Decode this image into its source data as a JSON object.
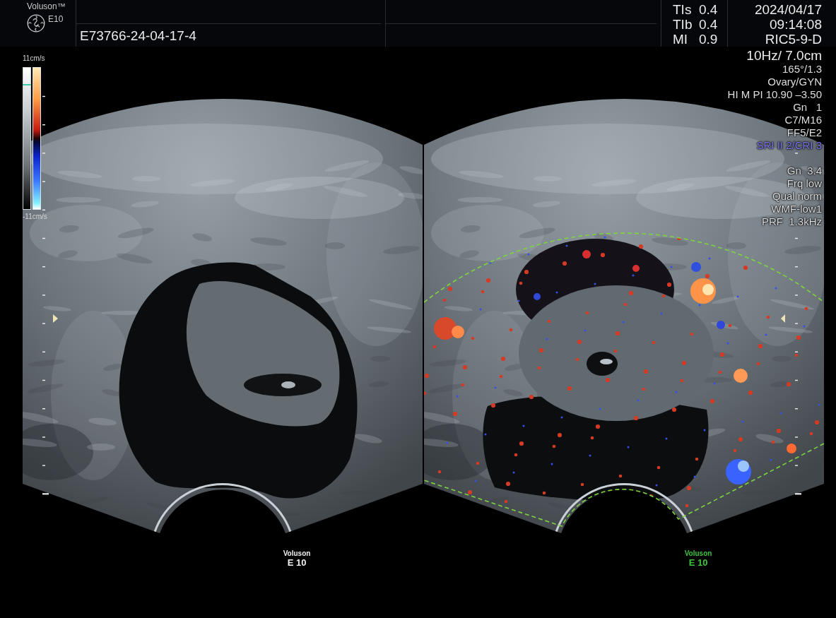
{
  "header": {
    "brand": "Voluson™",
    "model": "E10",
    "patient_id": "E73766-24-04-17-4"
  },
  "acoustic_output": [
    {
      "label": "TIs",
      "value": "0.4"
    },
    {
      "label": "TIb",
      "value": "0.4"
    },
    {
      "label": "MI",
      "value": "0.9"
    }
  ],
  "exam": {
    "date": "2024/04/17",
    "time": "09:14:08",
    "probe": "RIC5-9-D"
  },
  "parameter_groups": [
    [
      {
        "text": "10Hz/ 7.0cm",
        "kind": "primary"
      },
      {
        "text": "165°/1.3",
        "kind": "normal"
      },
      {
        "text": "Ovary/GYN",
        "kind": "normal"
      },
      {
        "text": "HI M PI 10.90 –3.50",
        "kind": "normal"
      },
      {
        "text": "Gn   1",
        "kind": "normal"
      },
      {
        "text": "C7/M16",
        "kind": "normal"
      },
      {
        "text": "FF5/E2",
        "kind": "normal"
      },
      {
        "text": "SRI II 2/CRI 3",
        "kind": "highlight"
      }
    ],
    [
      {
        "text": "Gn  3.4",
        "kind": "normal"
      },
      {
        "text": "Frq low",
        "kind": "normal"
      },
      {
        "text": "Qual norm",
        "kind": "normal"
      },
      {
        "text": "WMF-low1",
        "kind": "normal"
      },
      {
        "text": "PRF  1.3kHz",
        "kind": "normal"
      }
    ]
  ],
  "color_scale": {
    "max": "11cm/s",
    "min": "-11cm/s"
  },
  "images": [
    {
      "color_flow": false,
      "selected": false,
      "vendor": "Voluson",
      "model": "E 10"
    },
    {
      "color_flow": true,
      "selected": true,
      "vendor": "Voluson",
      "model": "E 10"
    }
  ]
}
